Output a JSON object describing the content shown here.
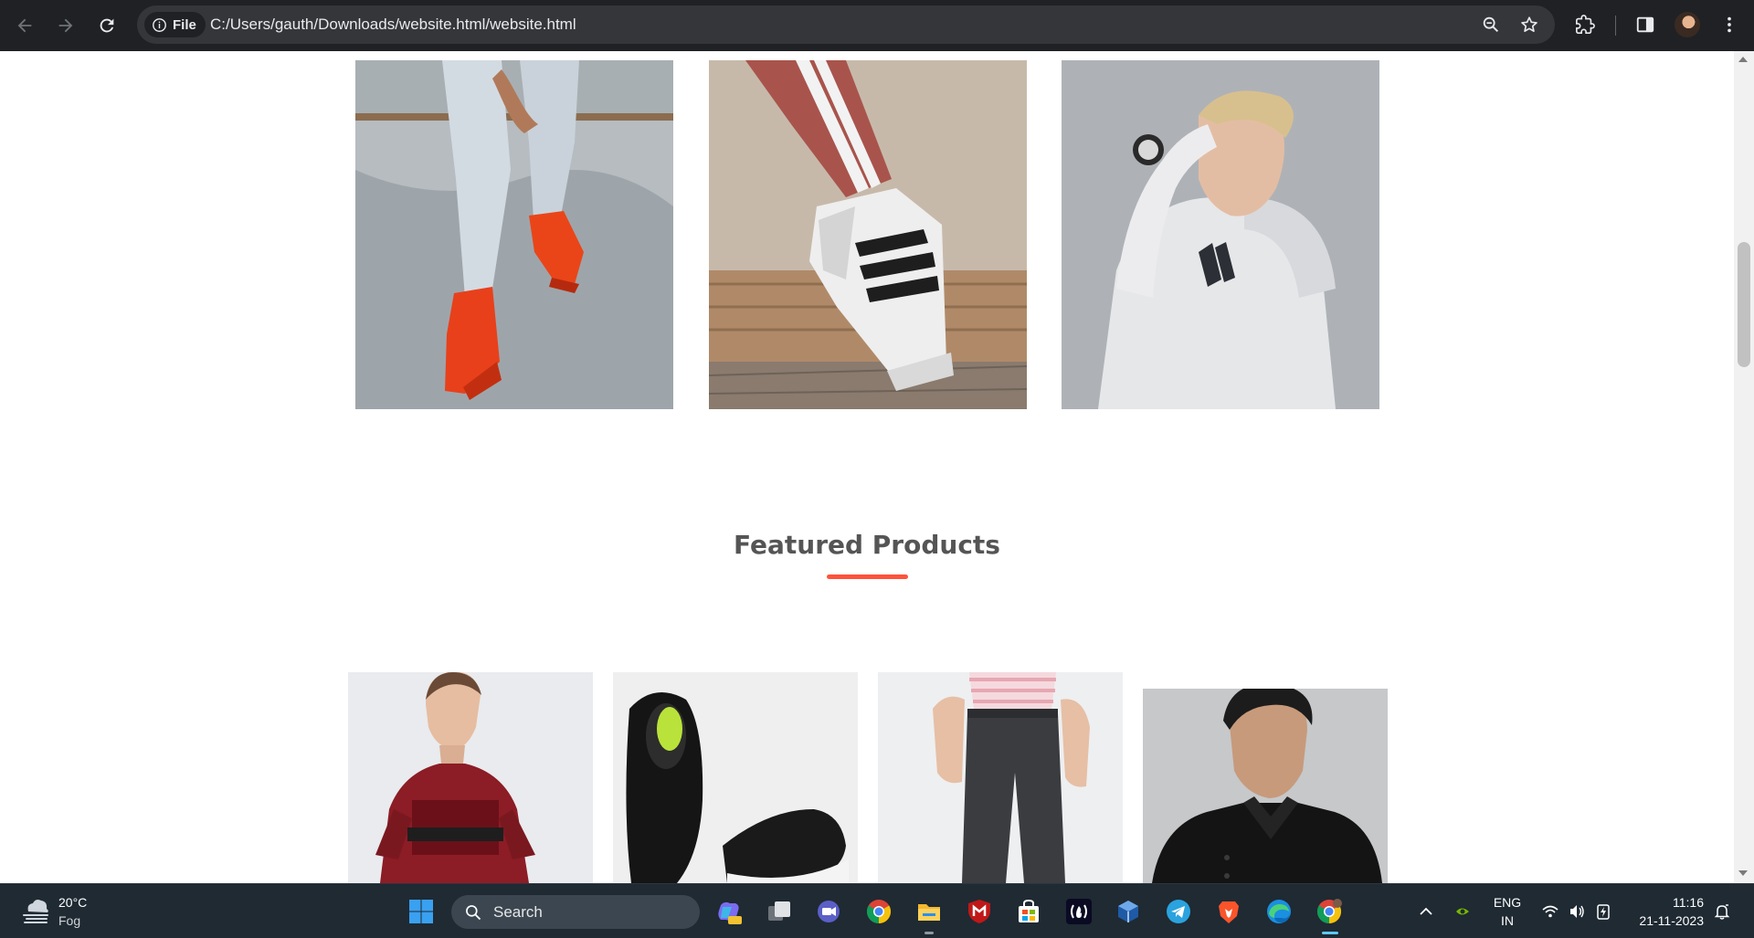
{
  "browser": {
    "site_chip_label": "File",
    "url": "C:/Users/gauth/Downloads/website.html/website.html",
    "icons": [
      "back-arrow-icon",
      "forward-arrow-icon",
      "reload-icon",
      "info-icon",
      "zoom-icon",
      "star-icon",
      "extensions-icon",
      "side-panel-icon",
      "profile-avatar",
      "more-icon"
    ]
  },
  "page": {
    "gallery": [
      {
        "name": "red-sneakers-photo"
      },
      {
        "name": "white-striped-sneaker-photo"
      },
      {
        "name": "woman-white-hoodie-photo"
      }
    ],
    "featured_title": "Featured Products",
    "accent_color": "#ff523b",
    "products": [
      {
        "name": "red-tshirt-product"
      },
      {
        "name": "black-shoes-product"
      },
      {
        "name": "grey-joggers-product"
      },
      {
        "name": "black-polo-product"
      }
    ]
  },
  "taskbar": {
    "weather": {
      "temp": "20°C",
      "desc": "Fog"
    },
    "search_label": "Search",
    "apps": [
      "windows-start",
      "copilot",
      "task-view",
      "teams-chat",
      "chrome",
      "file-explorer",
      "mcafee",
      "microsoft-store",
      "freecodecamp",
      "virtualbox",
      "telegram",
      "brave",
      "edge",
      "chrome-profile"
    ],
    "language": {
      "line1": "ENG",
      "line2": "IN"
    },
    "time": "11:16",
    "date": "21-11-2023"
  }
}
